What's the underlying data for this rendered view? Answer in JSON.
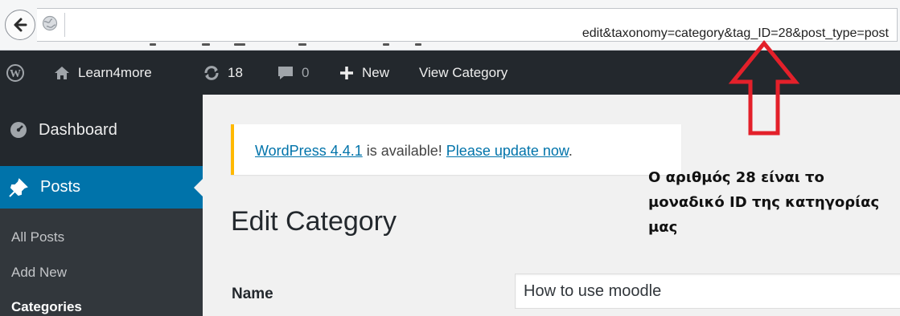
{
  "browser": {
    "url_visible": "edit&taxonomy=category&tag_ID=28&post_type=post"
  },
  "adminbar": {
    "site_name": "Learn4more",
    "updates_count": "18",
    "comments_count": "0",
    "new_label": "New",
    "view_label": "View Category"
  },
  "sidebar": {
    "dashboard": "Dashboard",
    "posts": "Posts",
    "submenu": [
      "All Posts",
      "Add New",
      "Categories"
    ]
  },
  "notice": {
    "version_link": "WordPress 4.4.1",
    "middle_text": " is available! ",
    "update_link": "Please update now",
    "end_text": "."
  },
  "page": {
    "title": "Edit Category",
    "name_label": "Name",
    "name_value": "How to use moodle"
  },
  "annotation": {
    "lines": [
      "Ο αριθμός 28 είναι το",
      "μοναδικό ID της κατηγορίας",
      "μας"
    ],
    "arrow_color": "#e3202a"
  },
  "colors": {
    "admin_bar": "#23282d",
    "active_menu": "#0073aa",
    "link": "#0073aa",
    "notice_border": "#ffb900"
  }
}
